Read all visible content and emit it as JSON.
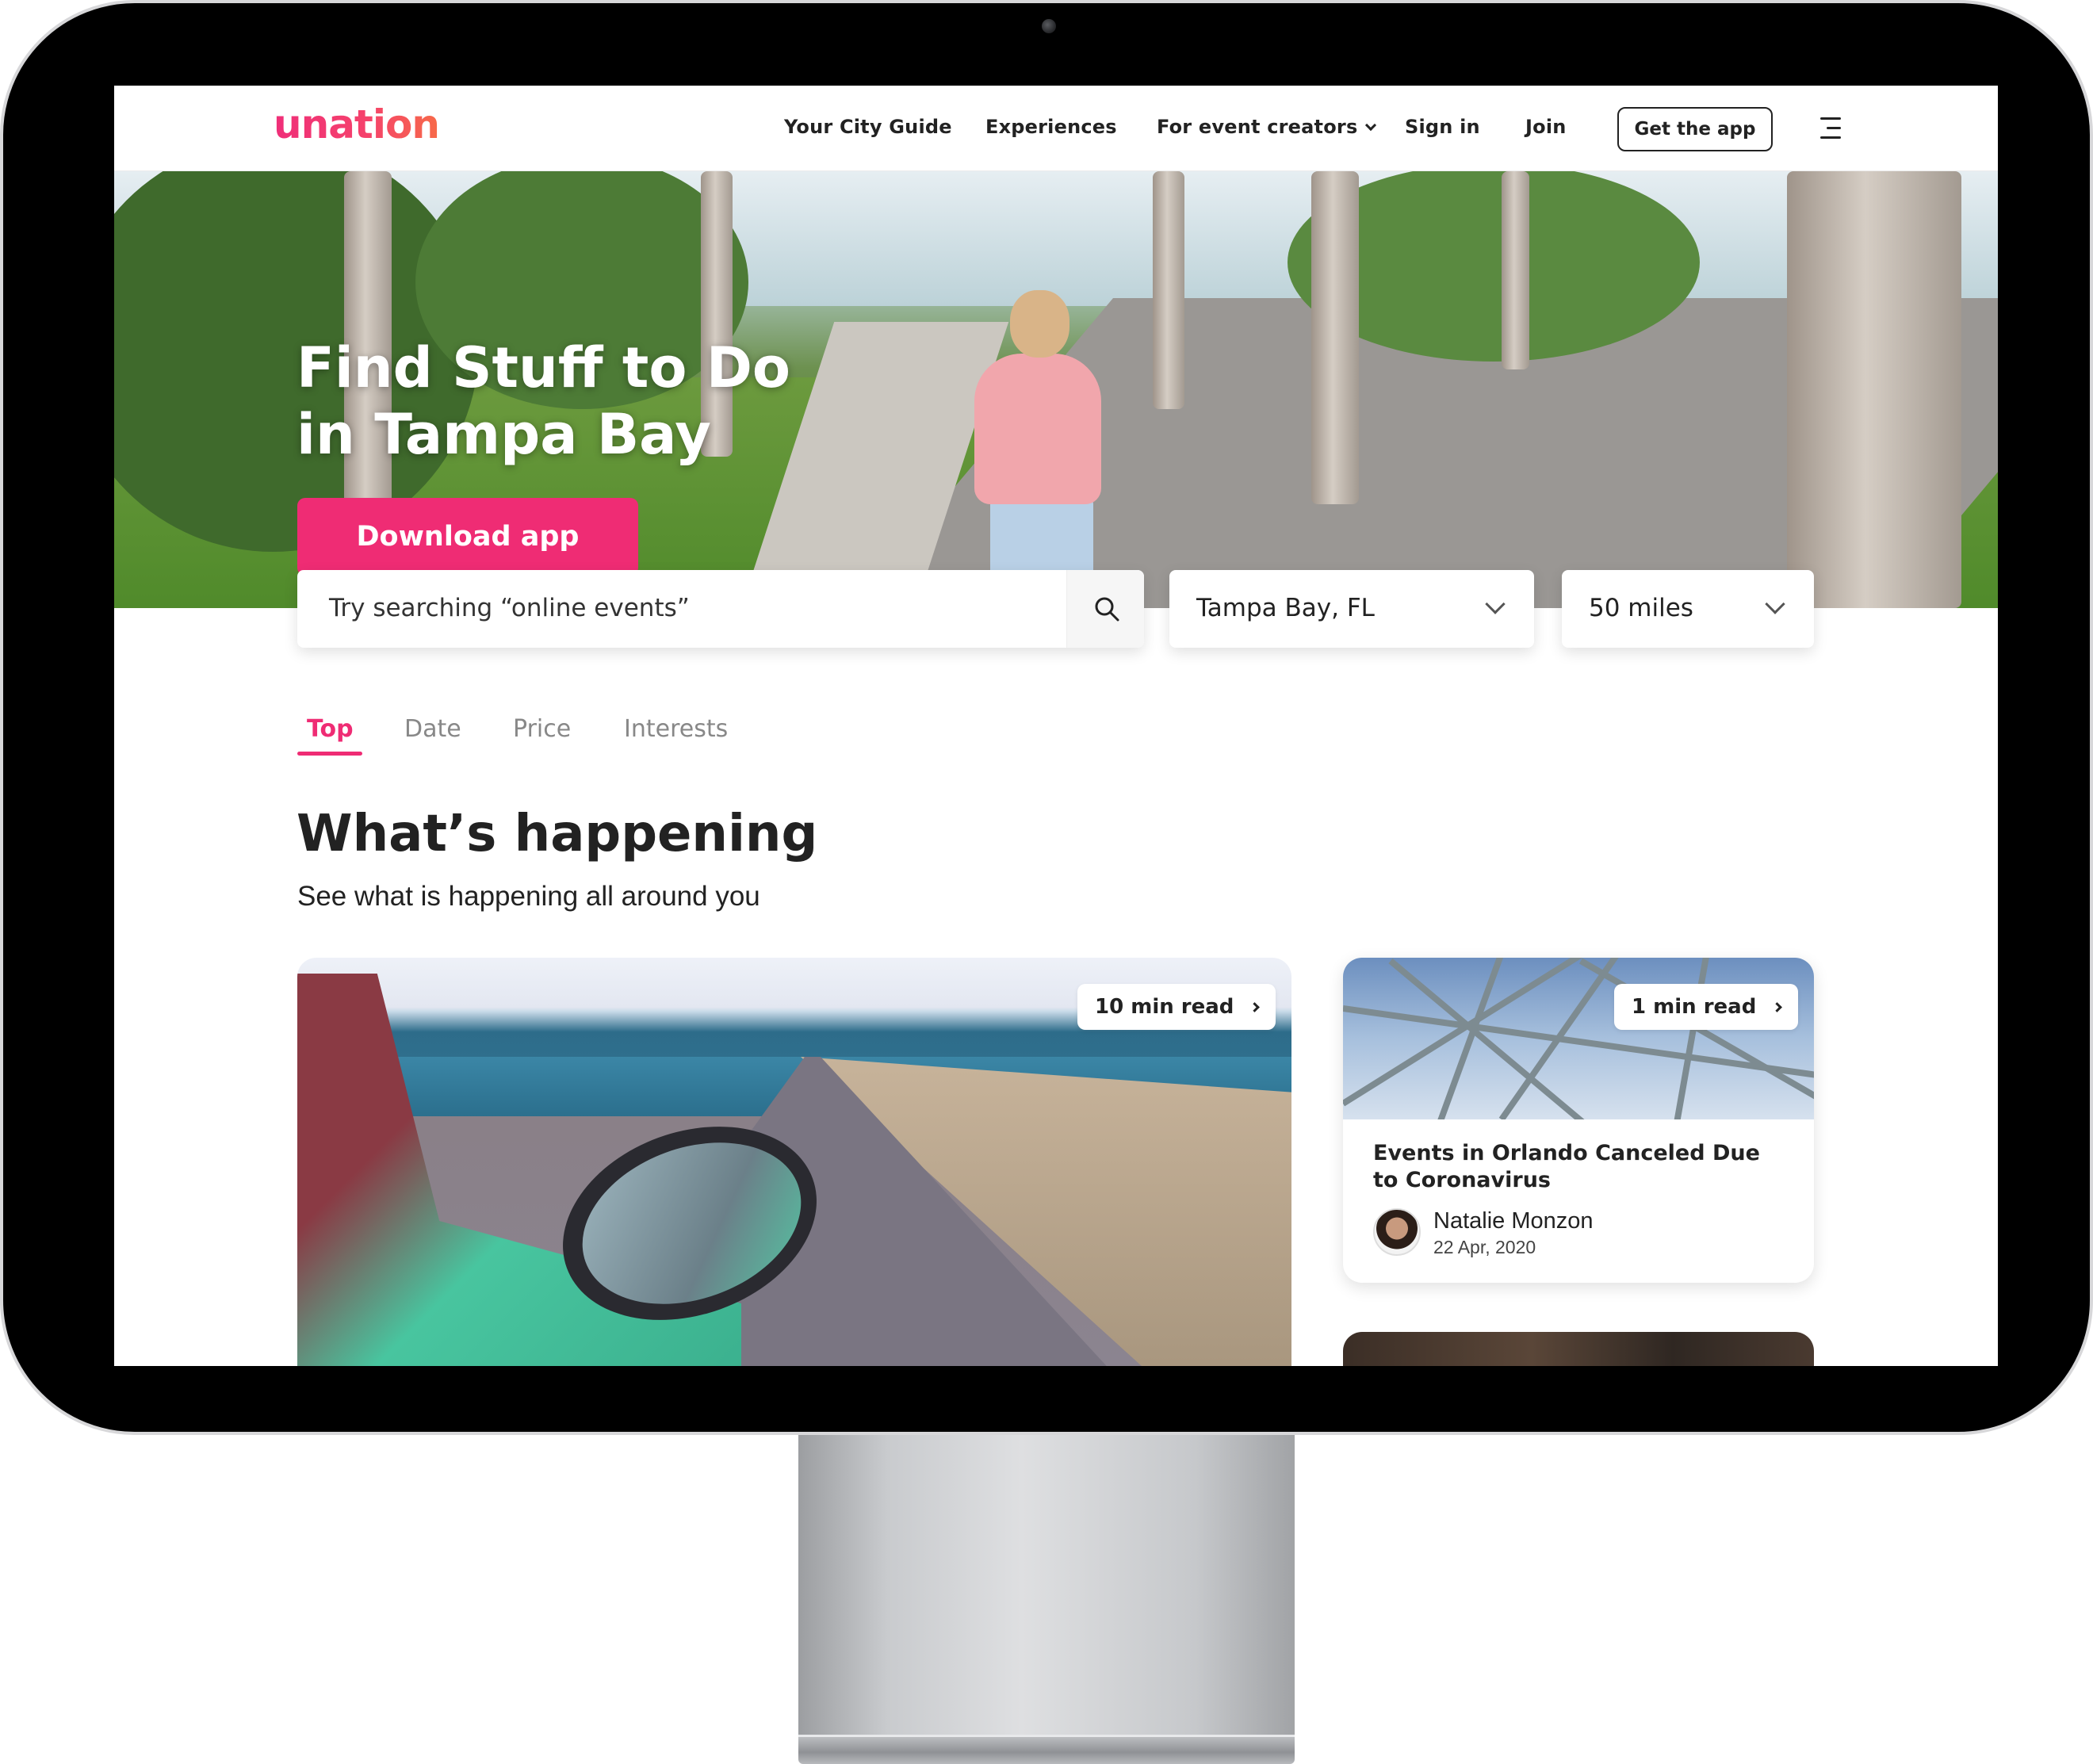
{
  "brand": {
    "name": "unation",
    "accent": "#ef2c74"
  },
  "header": {
    "nav": [
      "Your City Guide",
      "Experiences",
      "For event creators",
      "Sign in",
      "Join"
    ],
    "get_app_label": "Get the app"
  },
  "hero": {
    "title_line1": "Find Stuff to Do",
    "title_line2": "in Tampa Bay",
    "download_label": "Download app"
  },
  "search": {
    "placeholder": "Try searching “online events”",
    "location": "Tampa Bay, FL",
    "radius": "50 miles"
  },
  "tabs": [
    "Top",
    "Date",
    "Price",
    "Interests"
  ],
  "section": {
    "title": "What’s happening",
    "subtitle": "See what is happening all around you"
  },
  "cards": {
    "main": {
      "read_time": "10 min read"
    },
    "side": {
      "read_time": "1 min read",
      "title": "Events in Orlando Canceled Due to Coronavirus",
      "author": "Natalie Monzon",
      "date": "22 Apr, 2020"
    }
  }
}
